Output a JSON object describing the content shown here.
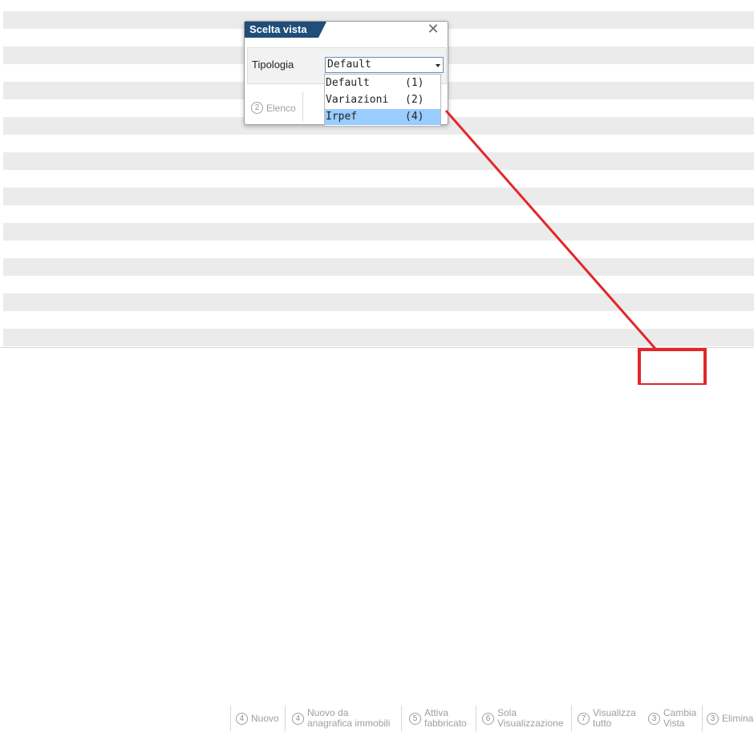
{
  "dialog": {
    "title": "Scelta vista",
    "tipologia_label": "Tipologia",
    "tipologia_value": "Default",
    "elenco_key": "2",
    "elenco_label": "Elenco",
    "options": [
      {
        "label": "Default",
        "key": "(1)",
        "selected": false
      },
      {
        "label": "Variazioni",
        "key": "(2)",
        "selected": false
      },
      {
        "label": "Irpef",
        "key": "(4)",
        "selected": true
      }
    ]
  },
  "toolbar": {
    "buttons": [
      {
        "key": "4",
        "lines": [
          "Nuovo"
        ]
      },
      {
        "key": "4",
        "lines": [
          "Nuovo da",
          "anagrafica immobili"
        ]
      },
      {
        "key": "5",
        "lines": [
          "Attiva",
          "fabbricato"
        ]
      },
      {
        "key": "6",
        "lines": [
          "Sola",
          "Visualizzazione"
        ]
      },
      {
        "key": "7",
        "lines": [
          "Visualizza",
          "tutto"
        ]
      },
      {
        "key": "3",
        "lines": [
          "Cambia",
          "Vista"
        ]
      },
      {
        "key": "3",
        "lines": [
          "Elimina"
        ]
      }
    ]
  },
  "colors": {
    "title_bar": "#1f4e79",
    "selected_option": "#99ccff",
    "annotation": "#e3262b",
    "stripe": "#ebebeb"
  }
}
